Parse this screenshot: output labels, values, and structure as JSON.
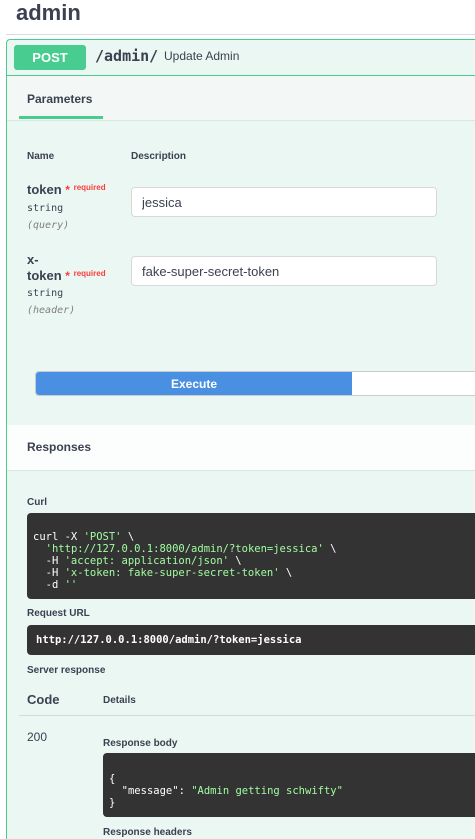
{
  "section": {
    "title": "admin"
  },
  "operation": {
    "method": "POST",
    "path": "/admin/",
    "summary": "Update Admin"
  },
  "parameters": {
    "tab_label": "Parameters",
    "col_name": "Name",
    "col_description": "Description",
    "items": [
      {
        "name_line1": "token",
        "name_line2": "",
        "required_star": "*",
        "required_text": "required",
        "type": "string",
        "in": "(query)",
        "value": "jessica"
      },
      {
        "name_line1": "x-",
        "name_line2": "token",
        "required_star": "*",
        "required_text": "required",
        "type": "string",
        "in": "(header)",
        "value": "fake-super-secret-token"
      }
    ]
  },
  "execute_label": "Execute",
  "responses": {
    "tab_label": "Responses",
    "curl_label": "Curl",
    "curl_lines": [
      {
        "a": "curl -X ",
        "b": "'POST'",
        "c": " \\"
      },
      {
        "a": "  ",
        "b": "'http://127.0.0.1:8000/admin/?token=jessica'",
        "c": " \\"
      },
      {
        "a": "  -H ",
        "b": "'accept: application/json'",
        "c": " \\"
      },
      {
        "a": "  -H ",
        "b": "'x-token: fake-super-secret-token'",
        "c": " \\"
      },
      {
        "a": "  -d ",
        "b": "''",
        "c": ""
      }
    ],
    "request_url_label": "Request URL",
    "request_url": "http://127.0.0.1:8000/admin/?token=jessica",
    "server_response_label": "Server response",
    "col_code": "Code",
    "col_details": "Details",
    "code": "200",
    "response_body_label": "Response body",
    "body_open": "{",
    "body_key": "\"message\"",
    "body_colon": ": ",
    "body_value": "\"Admin getting schwifty\"",
    "body_close": "}",
    "response_headers_label": "Response headers"
  }
}
